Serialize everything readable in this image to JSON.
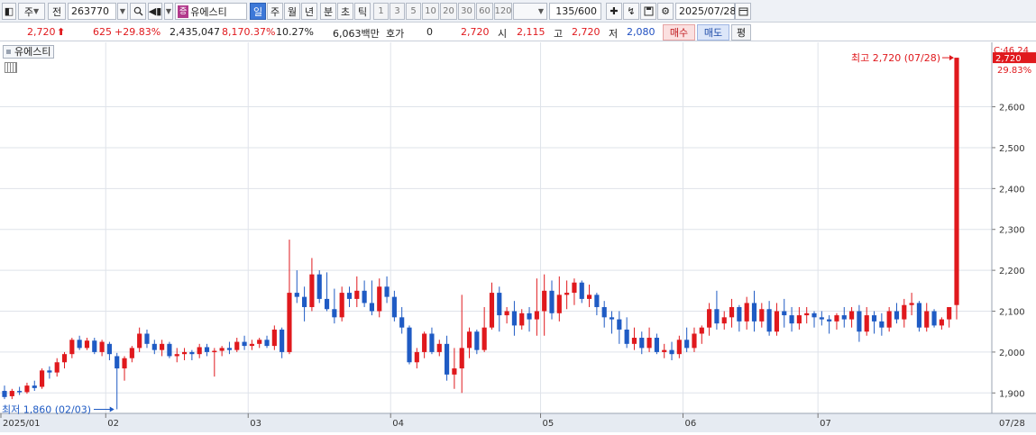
{
  "toolbar": {
    "market": "주",
    "prev_btn": "전",
    "code": "263770",
    "stock_badge": "증",
    "stock_name": "유에스티",
    "periods": [
      "일",
      "주",
      "월",
      "년",
      "분",
      "초",
      "틱"
    ],
    "active_period": "일",
    "intervals": [
      "1",
      "3",
      "5",
      "10",
      "20",
      "30",
      "60",
      "120"
    ],
    "count": "135/600",
    "date": "2025/07/28"
  },
  "quote": {
    "price": "2,720",
    "change": "625",
    "change_pct": "+29.83%",
    "volume": "2,435,047",
    "volume_pct": "8,170.37%",
    "turnover": "10.27%",
    "amount": "6,063백만",
    "hoga_label": "호가",
    "hoga_value": "0",
    "hoga_price": "2,720",
    "open_label": "시",
    "open": "2,115",
    "high_label": "고",
    "high": "2,720",
    "low_label": "저",
    "low": "2,080",
    "buy_label": "매수",
    "sell_label": "매도",
    "avg_label": "평"
  },
  "chart_data": {
    "type": "candlestick",
    "title": "유에스티",
    "y_ticks": [
      1900,
      2000,
      2100,
      2200,
      2300,
      2400,
      2500,
      2600
    ],
    "y_tick_labels": [
      "1,900",
      "2,000",
      "2,100",
      "2,200",
      "2,300",
      "2,400",
      "2,500",
      "2,600"
    ],
    "ylim": [
      1850,
      2740
    ],
    "x_month_labels": [
      "2025/01",
      "02",
      "03",
      "04",
      "05",
      "06",
      "07"
    ],
    "x_right_label": "07/28",
    "max_annotation": "최고 2,720 (07/28)",
    "min_annotation": "최저 1,860 (02/03)",
    "right_label_top": "C:46.24",
    "last_price_label": "2,720",
    "last_change_label": "29.83%",
    "up_color": "#e0191d",
    "down_color": "#1f5bc4",
    "month_start_index": [
      0,
      14,
      33,
      52,
      72,
      91,
      109
    ],
    "candles": [
      [
        1905,
        1918,
        1885,
        1890
      ],
      [
        1892,
        1910,
        1885,
        1905
      ],
      [
        1905,
        1915,
        1895,
        1902
      ],
      [
        1902,
        1925,
        1898,
        1918
      ],
      [
        1918,
        1930,
        1905,
        1912
      ],
      [
        1915,
        1960,
        1910,
        1955
      ],
      [
        1955,
        1965,
        1935,
        1950
      ],
      [
        1950,
        1985,
        1940,
        1975
      ],
      [
        1975,
        2000,
        1960,
        1995
      ],
      [
        1995,
        2035,
        1985,
        2030
      ],
      [
        2030,
        2040,
        2005,
        2010
      ],
      [
        2010,
        2035,
        2005,
        2028
      ],
      [
        2028,
        2035,
        1995,
        2000
      ],
      [
        2000,
        2030,
        1990,
        2025
      ],
      [
        2020,
        2025,
        1980,
        1995
      ],
      [
        1990,
        1998,
        1860,
        1960
      ],
      [
        1960,
        1990,
        1930,
        1985
      ],
      [
        1985,
        2015,
        1975,
        2010
      ],
      [
        2010,
        2060,
        2000,
        2045
      ],
      [
        2045,
        2055,
        2010,
        2020
      ],
      [
        2020,
        2030,
        1995,
        2005
      ],
      [
        2005,
        2030,
        1990,
        2020
      ],
      [
        2020,
        2025,
        1985,
        1990
      ],
      [
        1990,
        2010,
        1975,
        1995
      ],
      [
        1995,
        2010,
        1980,
        2000
      ],
      [
        2000,
        2005,
        1980,
        1995
      ],
      [
        1995,
        2020,
        1985,
        2012
      ],
      [
        2012,
        2020,
        1990,
        2000
      ],
      [
        2000,
        2010,
        1940,
        2003
      ],
      [
        2003,
        2015,
        1990,
        2010
      ],
      [
        2010,
        2025,
        1995,
        2005
      ],
      [
        2005,
        2035,
        2000,
        2025
      ],
      [
        2025,
        2040,
        2005,
        2015
      ],
      [
        2015,
        2030,
        2005,
        2020
      ],
      [
        2020,
        2035,
        2010,
        2030
      ],
      [
        2030,
        2040,
        2010,
        2015
      ],
      [
        2015,
        2065,
        2005,
        2055
      ],
      [
        2055,
        2060,
        1985,
        2000
      ],
      [
        2000,
        2275,
        1995,
        2145
      ],
      [
        2145,
        2200,
        2120,
        2135
      ],
      [
        2135,
        2160,
        2075,
        2110
      ],
      [
        2110,
        2230,
        2100,
        2190
      ],
      [
        2190,
        2200,
        2120,
        2130
      ],
      [
        2130,
        2195,
        2100,
        2105
      ],
      [
        2105,
        2155,
        2070,
        2085
      ],
      [
        2085,
        2160,
        2075,
        2145
      ],
      [
        2145,
        2160,
        2110,
        2130
      ],
      [
        2130,
        2185,
        2110,
        2150
      ],
      [
        2150,
        2175,
        2110,
        2120
      ],
      [
        2120,
        2175,
        2090,
        2100
      ],
      [
        2100,
        2180,
        2085,
        2160
      ],
      [
        2160,
        2185,
        2120,
        2135
      ],
      [
        2135,
        2150,
        2075,
        2085
      ],
      [
        2085,
        2110,
        2045,
        2060
      ],
      [
        2060,
        2065,
        1970,
        1975
      ],
      [
        1975,
        2010,
        1960,
        2000
      ],
      [
        2000,
        2050,
        1985,
        2045
      ],
      [
        2045,
        2060,
        1995,
        2000
      ],
      [
        2000,
        2030,
        1990,
        2020
      ],
      [
        2020,
        2040,
        1930,
        1945
      ],
      [
        1945,
        2010,
        1910,
        1960
      ],
      [
        1960,
        2140,
        1900,
        2010
      ],
      [
        2010,
        2060,
        1985,
        2050
      ],
      [
        2050,
        2055,
        1995,
        2005
      ],
      [
        2005,
        2110,
        2000,
        2060
      ],
      [
        2060,
        2170,
        2055,
        2145
      ],
      [
        2145,
        2160,
        2050,
        2090
      ],
      [
        2090,
        2110,
        2070,
        2100
      ],
      [
        2100,
        2125,
        2040,
        2065
      ],
      [
        2065,
        2105,
        2055,
        2095
      ],
      [
        2095,
        2110,
        2050,
        2080
      ],
      [
        2080,
        2180,
        2040,
        2100
      ],
      [
        2100,
        2190,
        2040,
        2150
      ],
      [
        2150,
        2175,
        2080,
        2095
      ],
      [
        2095,
        2185,
        2075,
        2140
      ],
      [
        2140,
        2175,
        2105,
        2145
      ],
      [
        2145,
        2180,
        2115,
        2170
      ],
      [
        2170,
        2175,
        2120,
        2130
      ],
      [
        2130,
        2165,
        2110,
        2140
      ],
      [
        2140,
        2145,
        2090,
        2110
      ],
      [
        2110,
        2125,
        2060,
        2085
      ],
      [
        2085,
        2100,
        2045,
        2080
      ],
      [
        2080,
        2100,
        2020,
        2055
      ],
      [
        2055,
        2085,
        2010,
        2020
      ],
      [
        2020,
        2060,
        2005,
        2035
      ],
      [
        2035,
        2050,
        1995,
        2010
      ],
      [
        2010,
        2060,
        2000,
        2035
      ],
      [
        2035,
        2045,
        1995,
        2000
      ],
      [
        2000,
        2020,
        1985,
        2005
      ],
      [
        2005,
        2025,
        1980,
        1995
      ],
      [
        1995,
        2040,
        1985,
        2030
      ],
      [
        2030,
        2060,
        2000,
        2010
      ],
      [
        2010,
        2060,
        2000,
        2045
      ],
      [
        2045,
        2065,
        2020,
        2060
      ],
      [
        2060,
        2120,
        2040,
        2105
      ],
      [
        2105,
        2150,
        2055,
        2070
      ],
      [
        2070,
        2100,
        2055,
        2085
      ],
      [
        2085,
        2130,
        2060,
        2110
      ],
      [
        2110,
        2115,
        2050,
        2075
      ],
      [
        2075,
        2135,
        2055,
        2120
      ],
      [
        2120,
        2150,
        2050,
        2075
      ],
      [
        2075,
        2120,
        2060,
        2105
      ],
      [
        2105,
        2125,
        2040,
        2050
      ],
      [
        2050,
        2120,
        2040,
        2100
      ],
      [
        2100,
        2130,
        2060,
        2090
      ],
      [
        2090,
        2110,
        2050,
        2070
      ],
      [
        2070,
        2110,
        2055,
        2090
      ],
      [
        2090,
        2110,
        2070,
        2095
      ],
      [
        2095,
        2100,
        2060,
        2085
      ],
      [
        2085,
        2100,
        2065,
        2080
      ],
      [
        2080,
        2090,
        2045,
        2075
      ],
      [
        2075,
        2095,
        2055,
        2090
      ],
      [
        2090,
        2110,
        2060,
        2080
      ],
      [
        2080,
        2110,
        2060,
        2100
      ],
      [
        2100,
        2115,
        2025,
        2050
      ],
      [
        2050,
        2110,
        2040,
        2090
      ],
      [
        2090,
        2100,
        2045,
        2075
      ],
      [
        2075,
        2095,
        2040,
        2060
      ],
      [
        2060,
        2110,
        2050,
        2100
      ],
      [
        2100,
        2120,
        2070,
        2080
      ],
      [
        2080,
        2130,
        2060,
        2115
      ],
      [
        2115,
        2145,
        2090,
        2120
      ],
      [
        2120,
        2125,
        2050,
        2060
      ],
      [
        2060,
        2120,
        2050,
        2100
      ],
      [
        2100,
        2105,
        2060,
        2065
      ],
      [
        2065,
        2085,
        2055,
        2080
      ],
      [
        2080,
        2110,
        2060,
        2110
      ],
      [
        2115,
        2720,
        2080,
        2720
      ]
    ]
  }
}
